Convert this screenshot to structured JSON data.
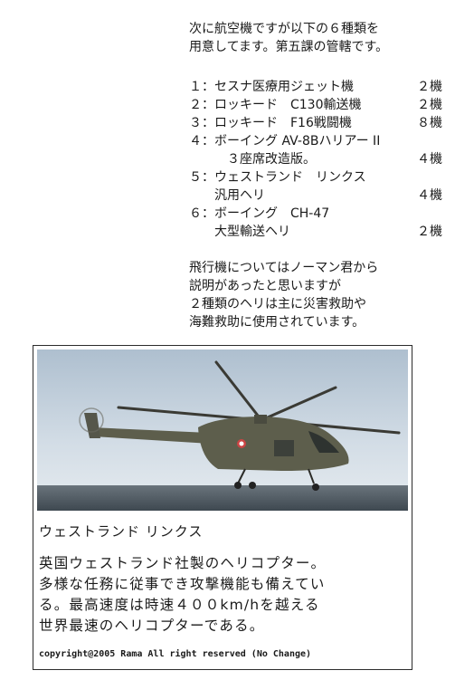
{
  "intro": {
    "line1": "次に航空機ですが以下の６種類を",
    "line2": "用意してます。第五課の管轄です。"
  },
  "aircraft": [
    {
      "label": "１：セスナ医療用ジェット機",
      "count": "２機"
    },
    {
      "label": "２：ロッキード　C130輸送機",
      "count": "２機"
    },
    {
      "label": "３：ロッキード　F16戦闘機",
      "count": "８機"
    },
    {
      "label": "４：ボーイング AV-8Bハリアー II",
      "count": ""
    },
    {
      "label": "　　　３座席改造版。",
      "count": "４機"
    },
    {
      "label": "５：ウェストランド　リンクス",
      "count": ""
    },
    {
      "label": "　　汎用ヘリ",
      "count": "４機"
    },
    {
      "label": "６：ボーイング　CH-47",
      "count": ""
    },
    {
      "label": "　　大型輸送ヘリ",
      "count": "２機"
    }
  ],
  "note": {
    "line1": "飛行機についてはノーマン君から",
    "line2": "説明があったと思いますが",
    "line3": "２種類のヘリは主に災害救助や",
    "line4": "海難救助に使用されています。"
  },
  "card": {
    "photo_subject": "Westland Lynx helicopter in flight over sea",
    "title": "ウェストランド リンクス",
    "body": [
      "英国ウェストランド社製のヘリコプター。",
      "多様な任務に従事でき攻撃機能も備えてい",
      "る。最高速度は時速４００km/hを越える",
      "世界最速のヘリコプターである。"
    ],
    "copyright": "copyright@2005 Rama All right reserved (No Change)"
  },
  "colors": {
    "sky": "#c9d6e2",
    "sea": "#4a5560",
    "heli": "#5d5e4c"
  }
}
